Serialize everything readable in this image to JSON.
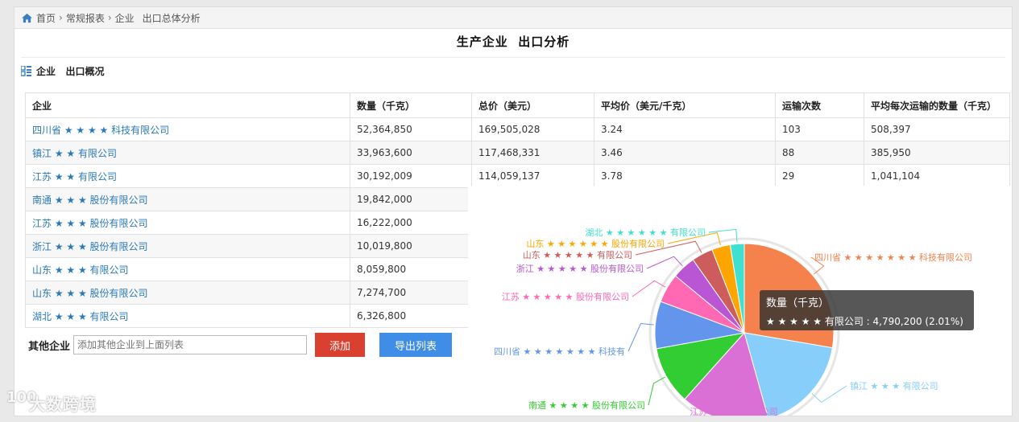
{
  "breadcrumb": {
    "items": [
      "首页",
      "常规报表",
      "企业",
      "出口总体分析"
    ]
  },
  "page_title": "生产企业  出口分析",
  "section_title": "企业   出口概况",
  "table": {
    "headers": [
      "企业",
      "数量（千克）",
      "总价（美元）",
      "平均价（美元/千克）",
      "运输次数",
      "平均每次运输的数量（千克）"
    ],
    "rows": [
      {
        "name": "四川省 ★ ★ ★ ★  科技有限公司",
        "qty": "52,364,850",
        "total": "169,505,028",
        "avg": "3.24",
        "trips": "103",
        "avg_trip": "508,397"
      },
      {
        "name": "镇江 ★ ★  有限公司",
        "qty": "33,963,600",
        "total": "117,468,331",
        "avg": "3.46",
        "trips": "88",
        "avg_trip": "385,950"
      },
      {
        "name": "江苏 ★ ★  有限公司",
        "qty": "30,192,009",
        "total": "114,059,137",
        "avg": "3.78",
        "trips": "29",
        "avg_trip": "1,041,104"
      },
      {
        "name": "南通 ★ ★ ★  股份有限公司",
        "qty": "19,842,000",
        "total": "",
        "avg": "",
        "trips": "",
        "avg_trip": ""
      },
      {
        "name": "江苏 ★ ★ ★   股份有限公司",
        "qty": "16,222,000",
        "total": "",
        "avg": "",
        "trips": "",
        "avg_trip": ""
      },
      {
        "name": "浙江 ★ ★ ★  股份有限公司",
        "qty": "10,019,800",
        "total": "",
        "avg": "",
        "trips": "",
        "avg_trip": ""
      },
      {
        "name": "山东 ★ ★ ★  有限公司",
        "qty": "8,059,800",
        "total": "",
        "avg": "",
        "trips": "",
        "avg_trip": ""
      },
      {
        "name": "山东 ★ ★ ★  股份有限公司",
        "qty": "7,274,700",
        "total": "",
        "avg": "",
        "trips": "",
        "avg_trip": ""
      },
      {
        "name": "湖北 ★ ★ ★   有限公司",
        "qty": "6,326,800",
        "total": "",
        "avg": "",
        "trips": "",
        "avg_trip": ""
      }
    ]
  },
  "other": {
    "label": "其他企业",
    "placeholder": "添加其他企业到上面列表",
    "add_label": "添加",
    "export_label": "导出列表"
  },
  "tooltip": {
    "title": "数量（千克）",
    "line": "★ ★ ★ ★ ★ 有限公司 : 4,790,200 (2.01%)"
  },
  "watermark": {
    "logo": "100",
    "text": "大数跨境"
  },
  "chart_data": {
    "type": "pie",
    "series": [
      {
        "name": "四川省 ★ ★ ★ ★ ★ ★ ★ 科技有限公司",
        "value": 52364850,
        "color": "#f5814c"
      },
      {
        "name": "镇江 ★ ★ ★ 有限公司",
        "value": 33963600,
        "color": "#87cefa"
      },
      {
        "name": "江苏 ★ ★ ★ 有限公司",
        "value": 30192009,
        "color": "#da70d6"
      },
      {
        "name": "南通 ★ ★ ★ ★ 股份有限公司",
        "value": 19842000,
        "color": "#32cd32"
      },
      {
        "name": "四川省 ★ ★ ★ ★ ★ ★ ★ 科技有",
        "value": 16222000,
        "color": "#6495ed"
      },
      {
        "name": "江苏 ★ ★ ★ ★ ★ 股份有限公司",
        "value": 10019800,
        "color": "#ff69b4"
      },
      {
        "name": "浙江 ★ ★ ★ ★ ★ 股份有限公司",
        "value": 8059800,
        "color": "#ba55d3"
      },
      {
        "name": "山东 ★ ★ ★ ★ ★ 有限公司",
        "value": 7274700,
        "color": "#cd5c5c"
      },
      {
        "name": "山东 ★ ★ ★ ★ ★ ★ 股份有限公司",
        "value": 6326800,
        "color": "#ffa500"
      },
      {
        "name": "湖北 ★ ★ ★ ★ ★ ★ 有限公司",
        "value": 4790200,
        "color": "#40e0d0"
      }
    ]
  }
}
